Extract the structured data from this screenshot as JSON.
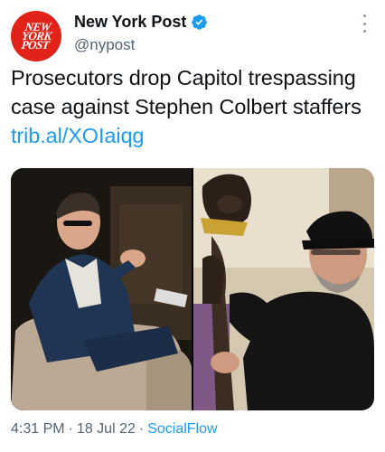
{
  "account": {
    "display_name": "New York Post",
    "handle": "@nypost",
    "avatar_logo_lines": [
      "NEW",
      "YORK",
      "POST"
    ],
    "verified": true
  },
  "tweet": {
    "text": "Prosecutors drop Capitol trespassing case against Stephen Colbert staffers",
    "link_text": "trib.al/XOIaiqg",
    "time": "4:31 PM",
    "separator": "·",
    "date": "18 Jul 22",
    "source": "SocialFlow"
  },
  "icons": {
    "verified": "verified-badge-icon",
    "more": "more-options-icon"
  },
  "colors": {
    "link": "#1d9bf0",
    "secondary_text": "#536471",
    "avatar_bg": "#e2231a"
  }
}
